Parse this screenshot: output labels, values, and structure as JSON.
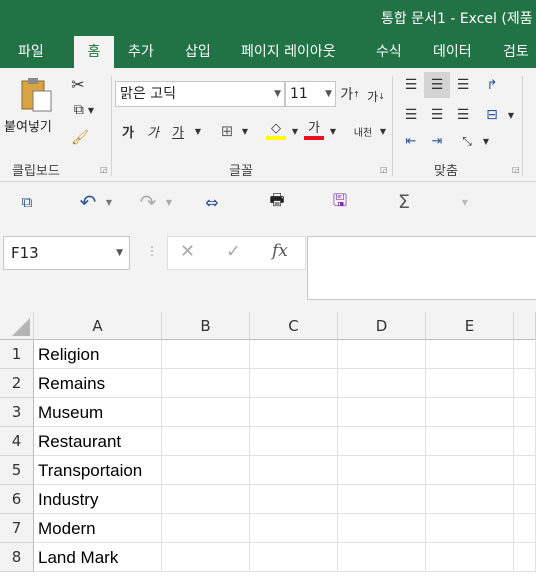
{
  "window": {
    "title": "통합 문서1 - Excel (제품"
  },
  "tabs": [
    "파일",
    "홈",
    "추가",
    "삽입",
    "페이지 레이아웃",
    "수식",
    "데이터",
    "검토"
  ],
  "active_tab": "홈",
  "ribbon": {
    "clipboard": {
      "paste_label": "붙여넣기",
      "group_label": "클립보드"
    },
    "font": {
      "font_name": "맑은 고딕",
      "font_size": "11",
      "group_label": "글꼴",
      "bold": "가",
      "italic": "가",
      "underline": "가",
      "font_color_glyph": "가",
      "grow": "가",
      "shrink": "가",
      "phonetic": "내천"
    },
    "alignment": {
      "group_label": "맞춤"
    },
    "colors": {
      "highlight": "#ffff00",
      "font_color": "#e81123"
    }
  },
  "formula_bar": {
    "name_box": "F13",
    "fx": "fx",
    "value": ""
  },
  "sheet": {
    "columns": [
      "A",
      "B",
      "C",
      "D",
      "E"
    ],
    "rows": [
      {
        "num": "1",
        "a": "Religion"
      },
      {
        "num": "2",
        "a": "Remains"
      },
      {
        "num": "3",
        "a": "Museum"
      },
      {
        "num": "4",
        "a": "Restaurant"
      },
      {
        "num": "5",
        "a": "Transportaion"
      },
      {
        "num": "6",
        "a": "Industry"
      },
      {
        "num": "7",
        "a": "Modern"
      },
      {
        "num": "8",
        "a": "Land Mark"
      }
    ]
  },
  "theme": {
    "accent": "#217346"
  }
}
